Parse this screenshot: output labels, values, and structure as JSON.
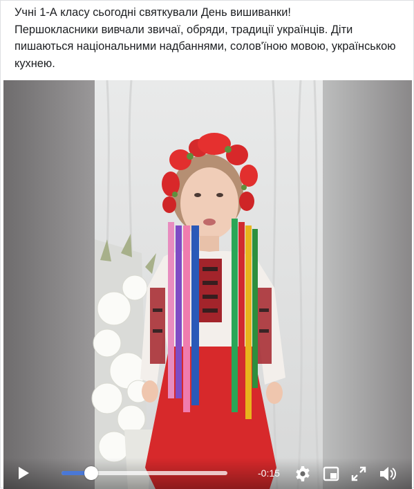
{
  "post": {
    "text": "Учні 1-А класу сьогодні святкували День вишиванки!\nПершокласники вивчали звичаї, обряди, традиції українців. Діти пишаються національними надбаннями, солов'їною мовою, українською кухнею."
  },
  "video": {
    "time_remaining": "-0:15",
    "progress": 0.18,
    "colors": {
      "progress_fill": "#4a78d6",
      "track": "#ffffff",
      "controls_icon": "#ffffff"
    },
    "icons": {
      "play": "play-icon",
      "settings": "gear-icon",
      "pip": "picture-in-picture-icon",
      "fullscreen": "expand-icon",
      "volume": "volume-icon"
    }
  }
}
